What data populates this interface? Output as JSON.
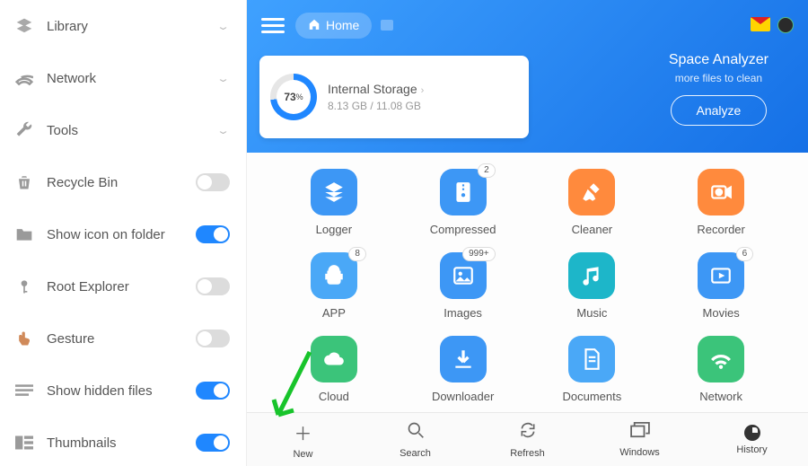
{
  "sidebar": {
    "items": [
      {
        "label": "Library",
        "expandable": true
      },
      {
        "label": "Network",
        "expandable": true
      },
      {
        "label": "Tools",
        "expandable": true
      },
      {
        "label": "Recycle Bin",
        "toggle": false
      },
      {
        "label": "Show icon on folder",
        "toggle": true
      },
      {
        "label": "Root Explorer",
        "toggle": false
      },
      {
        "label": "Gesture",
        "toggle": false
      },
      {
        "label": "Show hidden files",
        "toggle": true
      },
      {
        "label": "Thumbnails",
        "toggle": true
      }
    ]
  },
  "header": {
    "home_label": "Home",
    "storage": {
      "percent": "73",
      "percent_suffix": "%",
      "title": "Internal Storage",
      "usage": "8.13 GB / 11.08 GB"
    },
    "analyzer": {
      "title": "Space Analyzer",
      "subtitle": "more files to clean",
      "button": "Analyze"
    }
  },
  "grid": {
    "tiles": [
      {
        "label": "Logger",
        "color": "c-blue",
        "icon": "layers"
      },
      {
        "label": "Compressed",
        "color": "c-blue",
        "icon": "zip",
        "badge": "2"
      },
      {
        "label": "Cleaner",
        "color": "c-orange",
        "icon": "broom"
      },
      {
        "label": "Recorder",
        "color": "c-orange",
        "icon": "rec"
      },
      {
        "label": "APP",
        "color": "c-sky",
        "icon": "android",
        "badge": "8"
      },
      {
        "label": "Images",
        "color": "c-blue",
        "icon": "image",
        "badge": "999+"
      },
      {
        "label": "Music",
        "color": "c-teal",
        "icon": "music"
      },
      {
        "label": "Movies",
        "color": "c-blue",
        "icon": "movie",
        "badge": "6"
      },
      {
        "label": "Cloud",
        "color": "c-green",
        "icon": "cloud"
      },
      {
        "label": "Downloader",
        "color": "c-blue",
        "icon": "download"
      },
      {
        "label": "Documents",
        "color": "c-sky",
        "icon": "doc"
      },
      {
        "label": "Network",
        "color": "c-green",
        "icon": "net"
      }
    ]
  },
  "bottombar": {
    "actions": [
      {
        "label": "New"
      },
      {
        "label": "Search"
      },
      {
        "label": "Refresh"
      },
      {
        "label": "Windows"
      },
      {
        "label": "History"
      }
    ]
  }
}
